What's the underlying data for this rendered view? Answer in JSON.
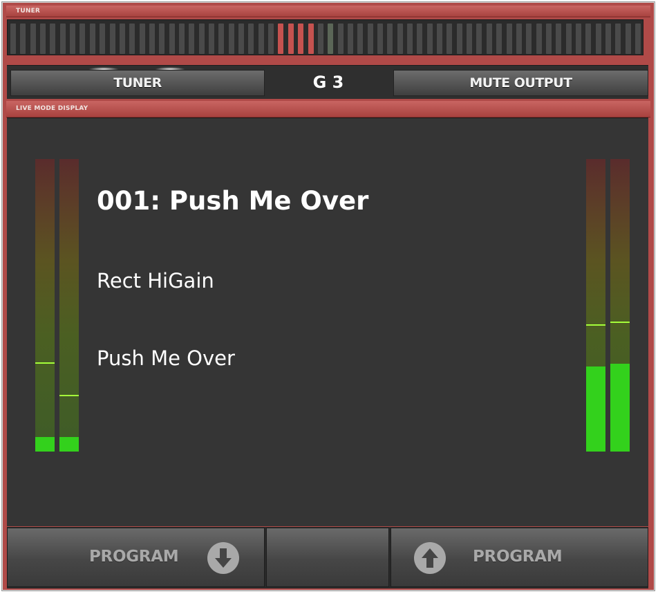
{
  "headers": {
    "tuner": "TUNER",
    "live_mode": "LIVE MODE DISPLAY"
  },
  "tuner": {
    "button_label": "TUNER",
    "note": "G 3",
    "mute_label": "MUTE OUTPUT"
  },
  "display": {
    "preset_title": "001: Push Me Over",
    "amp_name": "Rect HiGain",
    "preset_name": "Push Me Over"
  },
  "meters": {
    "input": [
      {
        "level": 0.05,
        "peak": 0.3
      },
      {
        "level": 0.05,
        "peak": 0.19
      }
    ],
    "output": [
      {
        "level": 0.29,
        "peak": 0.43
      },
      {
        "level": 0.3,
        "peak": 0.44
      }
    ]
  },
  "buttons": {
    "program_down": "PROGRAM",
    "program_up": "PROGRAM"
  },
  "colors": {
    "chrome_red": "#b04a48",
    "meter_green": "#33d11c",
    "peak_green": "#a5ff3a",
    "tuner_active": "#c5524f"
  }
}
